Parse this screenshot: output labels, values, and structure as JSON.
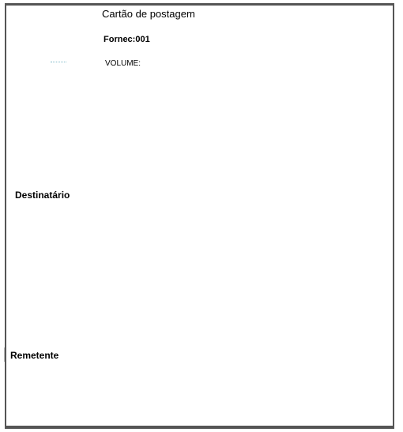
{
  "card": {
    "title": "Cartão de postagem",
    "supplier": "Fornec:001",
    "volume_label": "VOLUME:",
    "recipient_label": "Destinatário",
    "sender_label": "Remetente"
  }
}
